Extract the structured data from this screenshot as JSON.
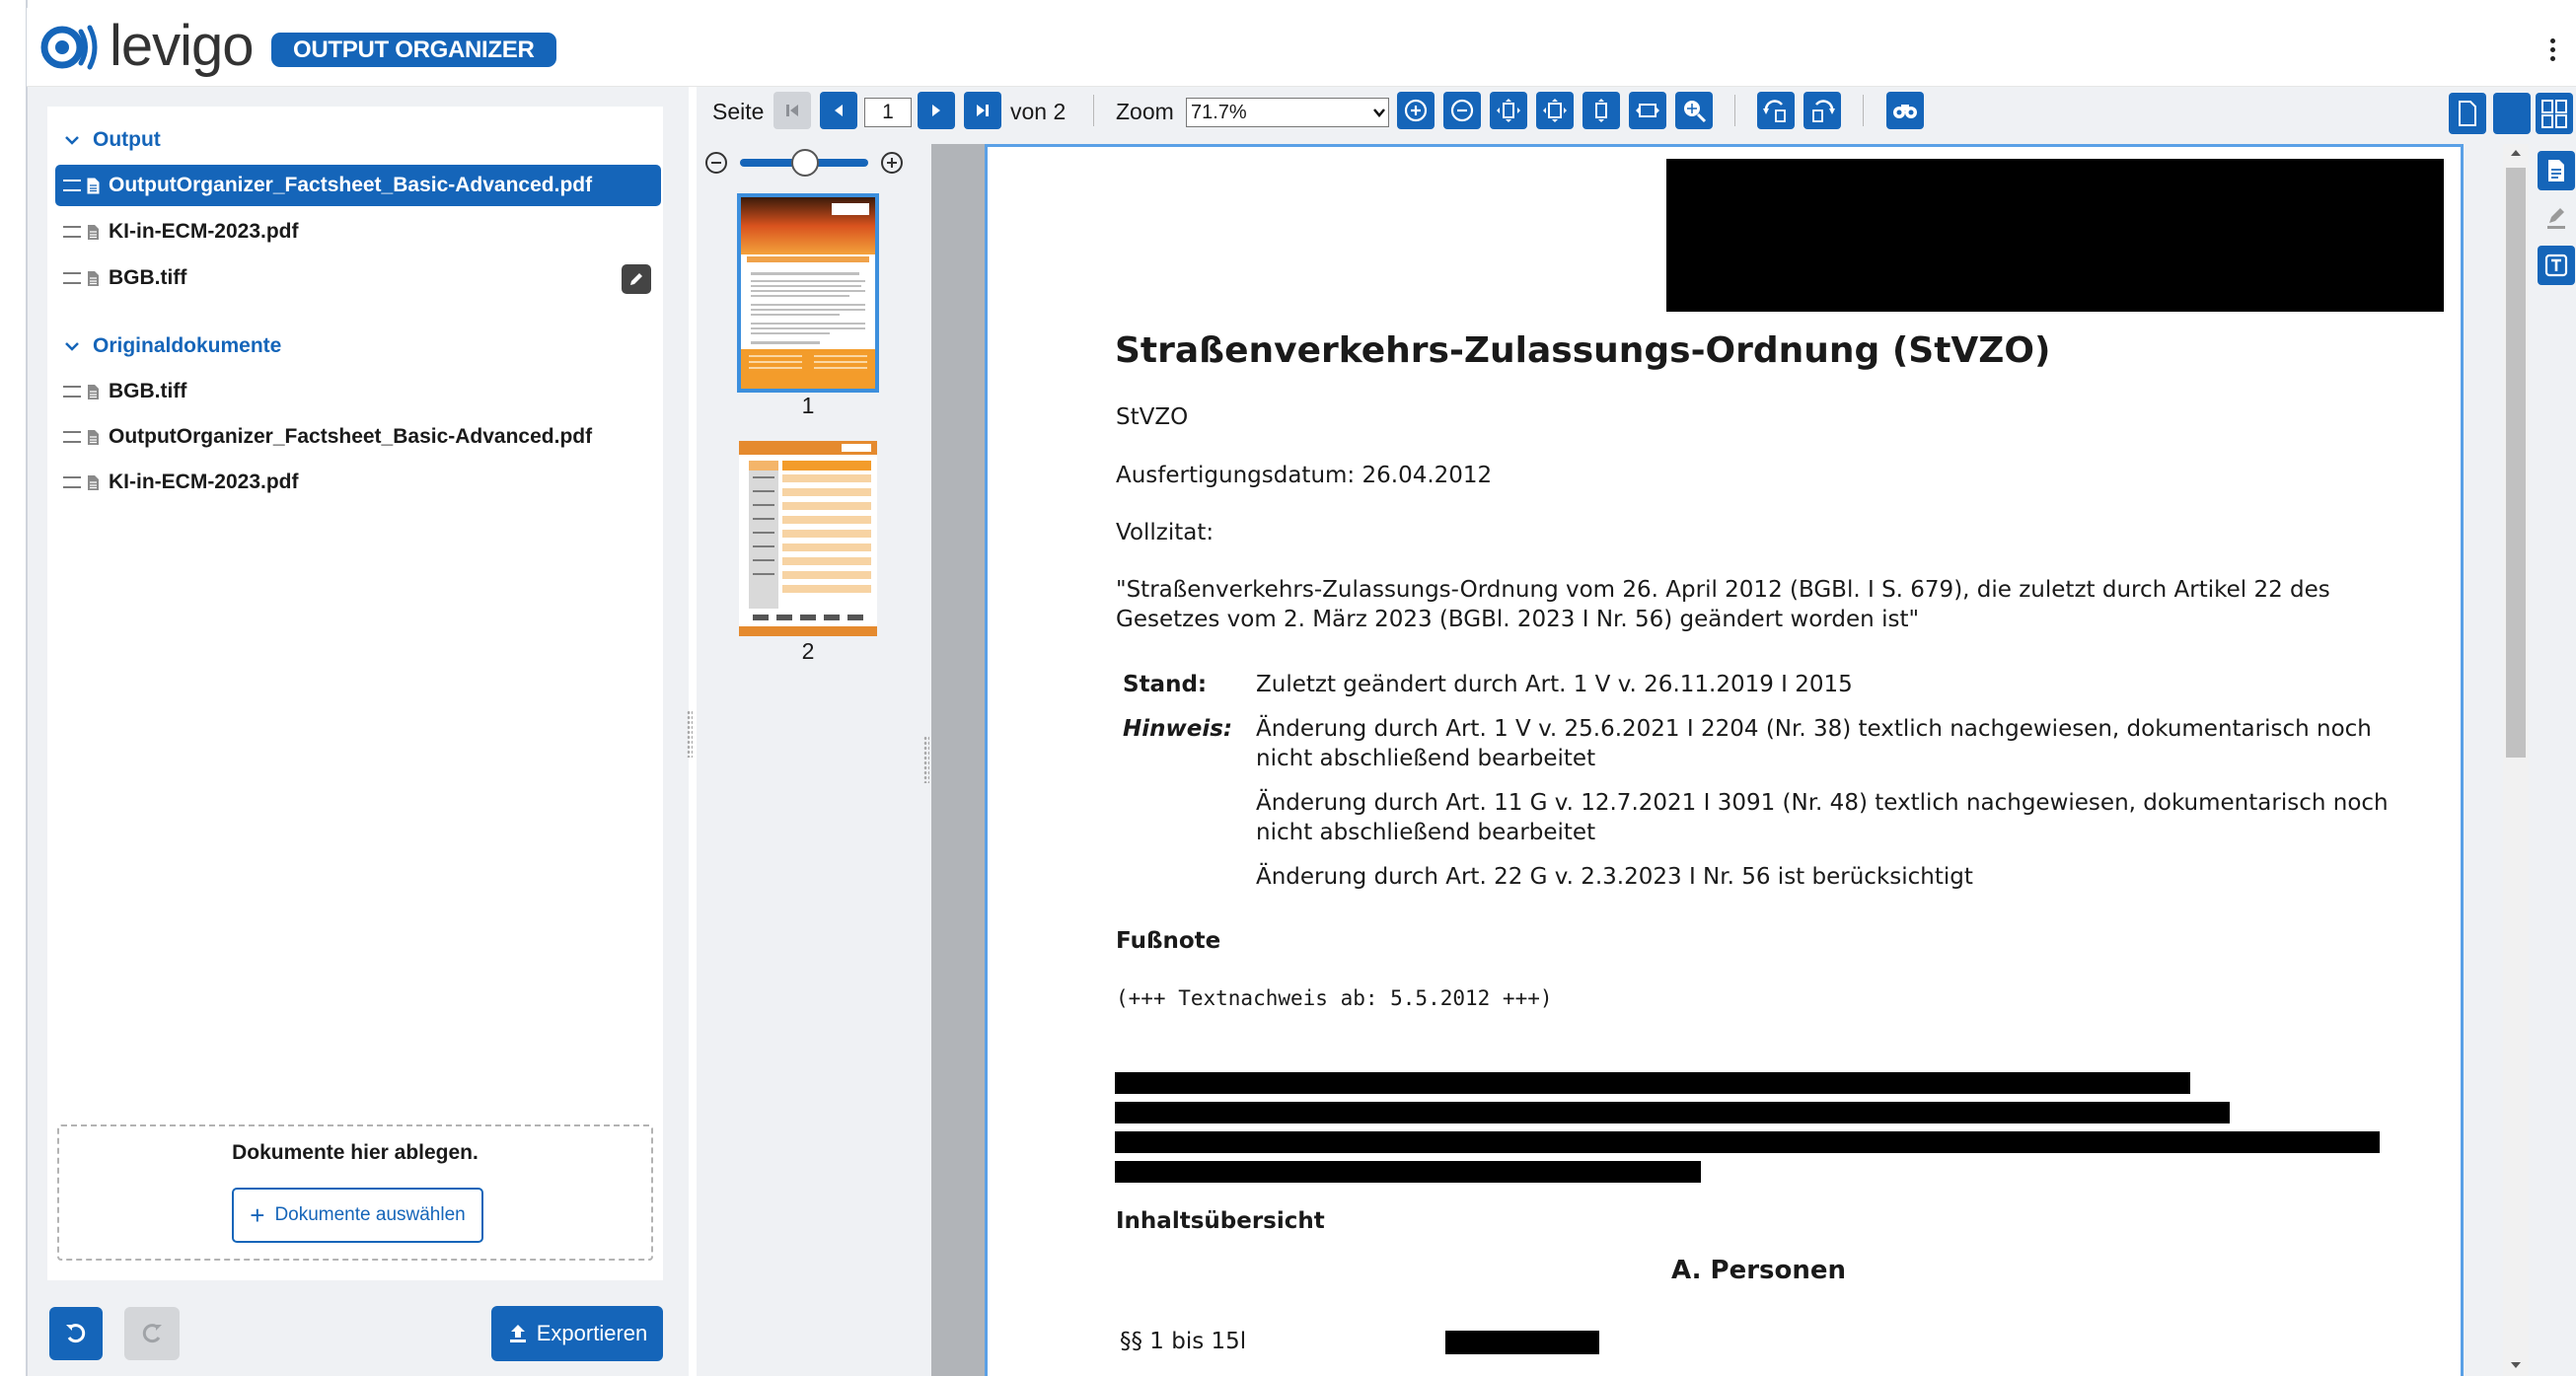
{
  "header": {
    "logo_text": "levigo",
    "product_badge": "OUTPUT ORGANIZER",
    "menu_icon": "kebab-menu-icon"
  },
  "sidebar": {
    "output_section": {
      "title": "Output",
      "files": [
        {
          "name": "OutputOrganizer_Factsheet_Basic-Advanced.pdf",
          "selected": true
        },
        {
          "name": "KI-in-ECM-2023.pdf",
          "selected": false
        },
        {
          "name": "BGB.tiff",
          "selected": false
        }
      ]
    },
    "original_section": {
      "title": "Originaldokumente",
      "files": [
        {
          "name": "BGB.tiff"
        },
        {
          "name": "OutputOrganizer_Factsheet_Basic-Advanced.pdf"
        },
        {
          "name": "KI-in-ECM-2023.pdf"
        }
      ]
    },
    "dropzone": {
      "text": "Dokumente hier ablegen.",
      "button_label": "Dokumente auswählen"
    },
    "export_label": "Exportieren"
  },
  "toolbar": {
    "page_label": "Seite",
    "page_value": "1",
    "of_label": "von 2",
    "zoom_label": "Zoom",
    "zoom_value": "71.7%"
  },
  "thumbnails": [
    {
      "number": "1",
      "selected": true
    },
    {
      "number": "2",
      "selected": false
    }
  ],
  "document": {
    "title": "Straßenverkehrs-Zulassungs-Ordnung (StVZO)",
    "abbr": "StVZO",
    "date_line": "Ausfertigungsdatum: 26.04.2012",
    "vollzitat_label": "Vollzitat:",
    "citation_line1": "\"Straßenverkehrs-Zulassungs-Ordnung vom 26. April 2012 (BGBl. I S. 679), die zuletzt durch Artikel 22 des",
    "citation_line2": "Gesetzes vom 2. März 2023 (BGBl. 2023 I Nr. 56) geändert worden ist\"",
    "stand_label": "Stand:",
    "stand_text": "Zuletzt geändert durch Art. 1 V v. 26.11.2019 I 2015",
    "hinweis_label": "Hinweis:",
    "hinweis1_line1": "Änderung durch Art. 1 V v. 25.6.2021 I 2204 (Nr. 38) textlich nachgewiesen, dokumentarisch noch",
    "hinweis1_line2": "nicht abschließend bearbeitet",
    "hinweis2_line1": "Änderung durch Art. 11 G v. 12.7.2021 I 3091 (Nr. 48) textlich nachgewiesen, dokumentarisch noch",
    "hinweis2_line2": "nicht abschließend bearbeitet",
    "hinweis3": "Änderung durch Art. 22 G v. 2.3.2023 I Nr. 56 ist berücksichtigt",
    "fussnote_label": "Fußnote",
    "textnachweis": "(+++ Textnachweis ab: 5.5.2012 +++)",
    "inhalt_label": "Inhaltsübersicht",
    "section_a": "A. Personen",
    "paragraph_range": "§§ 1 bis 15l"
  },
  "colors": {
    "accent": "#1565b9",
    "panel_bg": "#eff1f4",
    "page_border": "#5aa0e6",
    "redaction": "#000000"
  }
}
